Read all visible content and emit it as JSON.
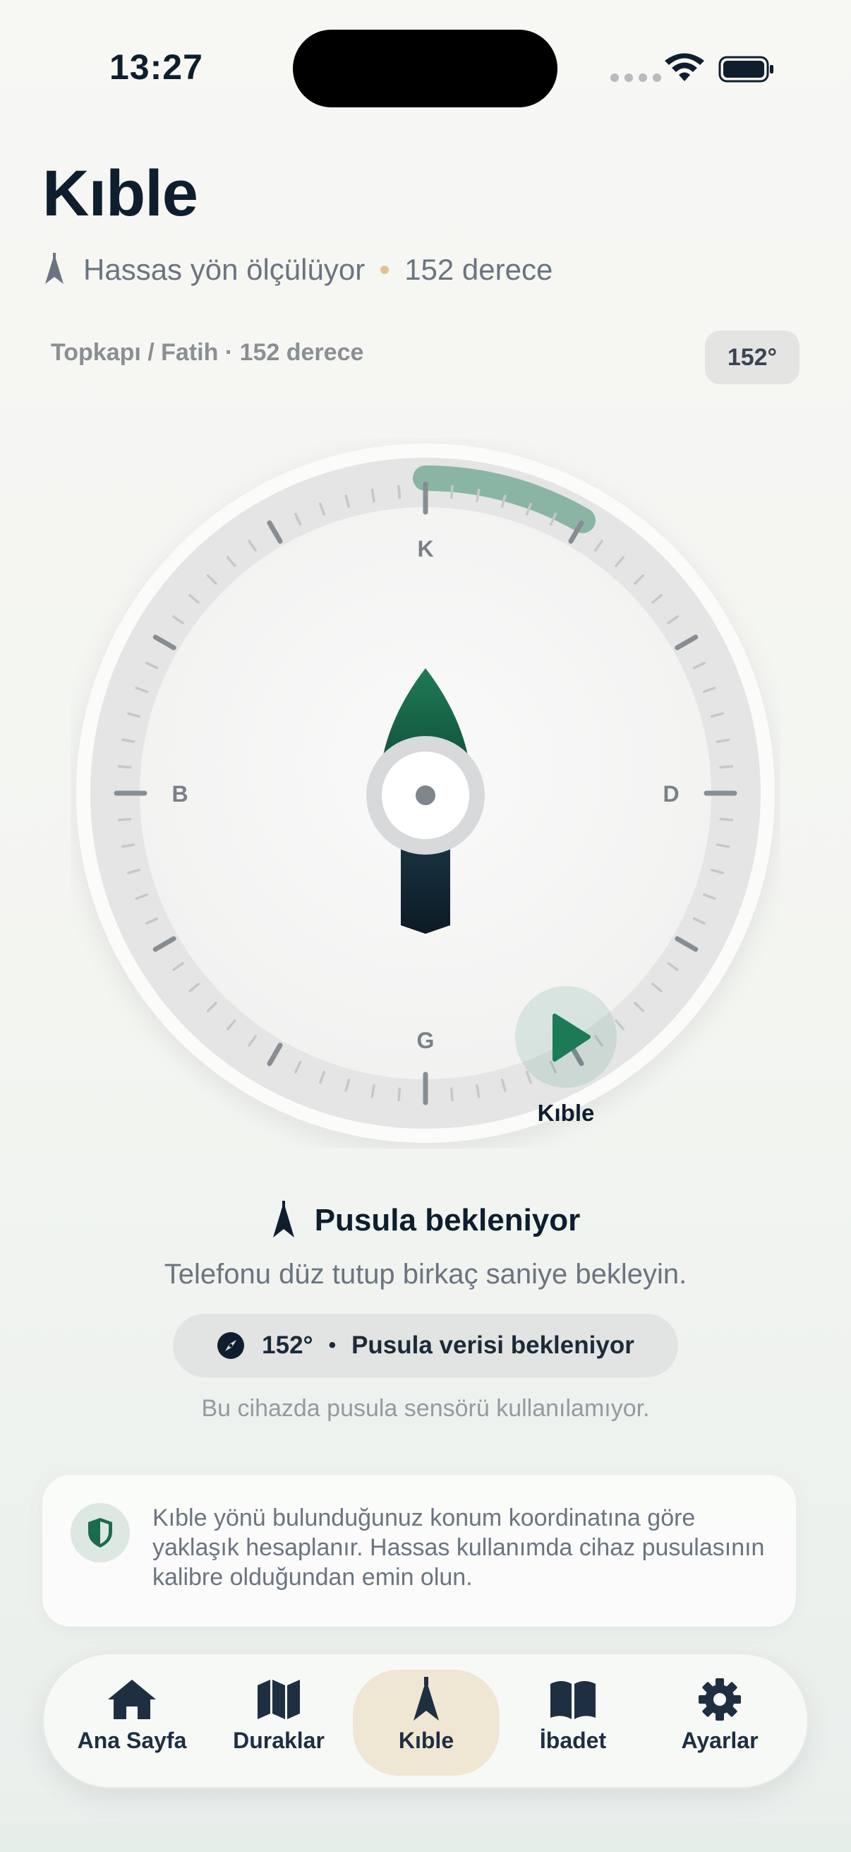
{
  "status_bar": {
    "time": "13:27"
  },
  "header": {
    "title": "Kıble",
    "measuring": "Hassas yön ölçülüyor",
    "degree_text": "152 derece"
  },
  "location": {
    "label": "Topkapı / Fatih · 152 derece",
    "badge": "152°"
  },
  "compass": {
    "north": "K",
    "south": "G",
    "west": "B",
    "east": "D",
    "qibla_label": "Kıble",
    "qibla_bearing_deg": 152,
    "accent_color": "#1c6b4f"
  },
  "status": {
    "title": "Pusula bekleniyor",
    "hint": "Telefonu düz tutup birkaç saniye bekleyin.",
    "pill_degree": "152°",
    "pill_bullet": "•",
    "pill_text": "Pusula verisi bekleniyor",
    "sensor_note": "Bu cihazda pusula sensörü kullanılamıyor."
  },
  "info": {
    "text": "Kıble yönü bulunduğunuz konum koordinatına göre yaklaşık hesaplanır. Hassas kullanımda cihaz pusulasının kalibre olduğundan emin olun."
  },
  "tabs": [
    {
      "label": "Ana Sayfa",
      "icon": "home-icon"
    },
    {
      "label": "Duraklar",
      "icon": "map-icon"
    },
    {
      "label": "Kıble",
      "icon": "qibla-needle-icon",
      "active": true
    },
    {
      "label": "İbadet",
      "icon": "book-icon"
    },
    {
      "label": "Ayarlar",
      "icon": "gear-icon"
    }
  ]
}
